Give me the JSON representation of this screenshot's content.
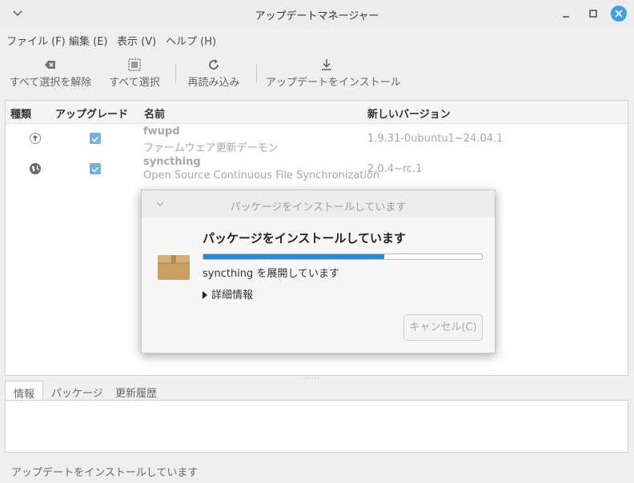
{
  "window": {
    "title": "アップデートマネージャー"
  },
  "menubar": {
    "file": "ファイル (F)",
    "edit": "編集 (E)",
    "view": "表示 (V)",
    "help": "ヘルプ (H)"
  },
  "toolbar": {
    "deselect_all": "すべて選択を解除",
    "select_all": "すべて選択",
    "refresh": "再読み込み",
    "install": "アップデートをインストール"
  },
  "table": {
    "headers": {
      "type": "種類",
      "upgrade": "アップグレード",
      "name": "名前",
      "new_version": "新しいバージョン"
    },
    "rows": [
      {
        "type_icon": "package-update-icon",
        "checked": true,
        "name": "fwupd",
        "description": "ファームウェア更新デーモン",
        "version": "1.9.31-0ubuntu1~24.04.1"
      },
      {
        "type_icon": "globe-icon",
        "checked": true,
        "name": "syncthing",
        "description": "Open Source Continuous File Synchronization",
        "version": "2.0.4~rc.1"
      }
    ]
  },
  "tabs": {
    "info": "情報",
    "packages": "パッケージ",
    "history": "更新履歴"
  },
  "statusbar": {
    "text": "アップデートをインストールしています"
  },
  "dialog": {
    "title": "パッケージをインストールしています",
    "heading": "パッケージをインストールしています",
    "progress": 0.65,
    "status": "syncthing を展開しています",
    "details": "詳細情報",
    "cancel": "キャンセル(C)"
  },
  "colors": {
    "accent": "#2b8ad2",
    "close": "#3da0e0",
    "check": "#74b1de"
  }
}
